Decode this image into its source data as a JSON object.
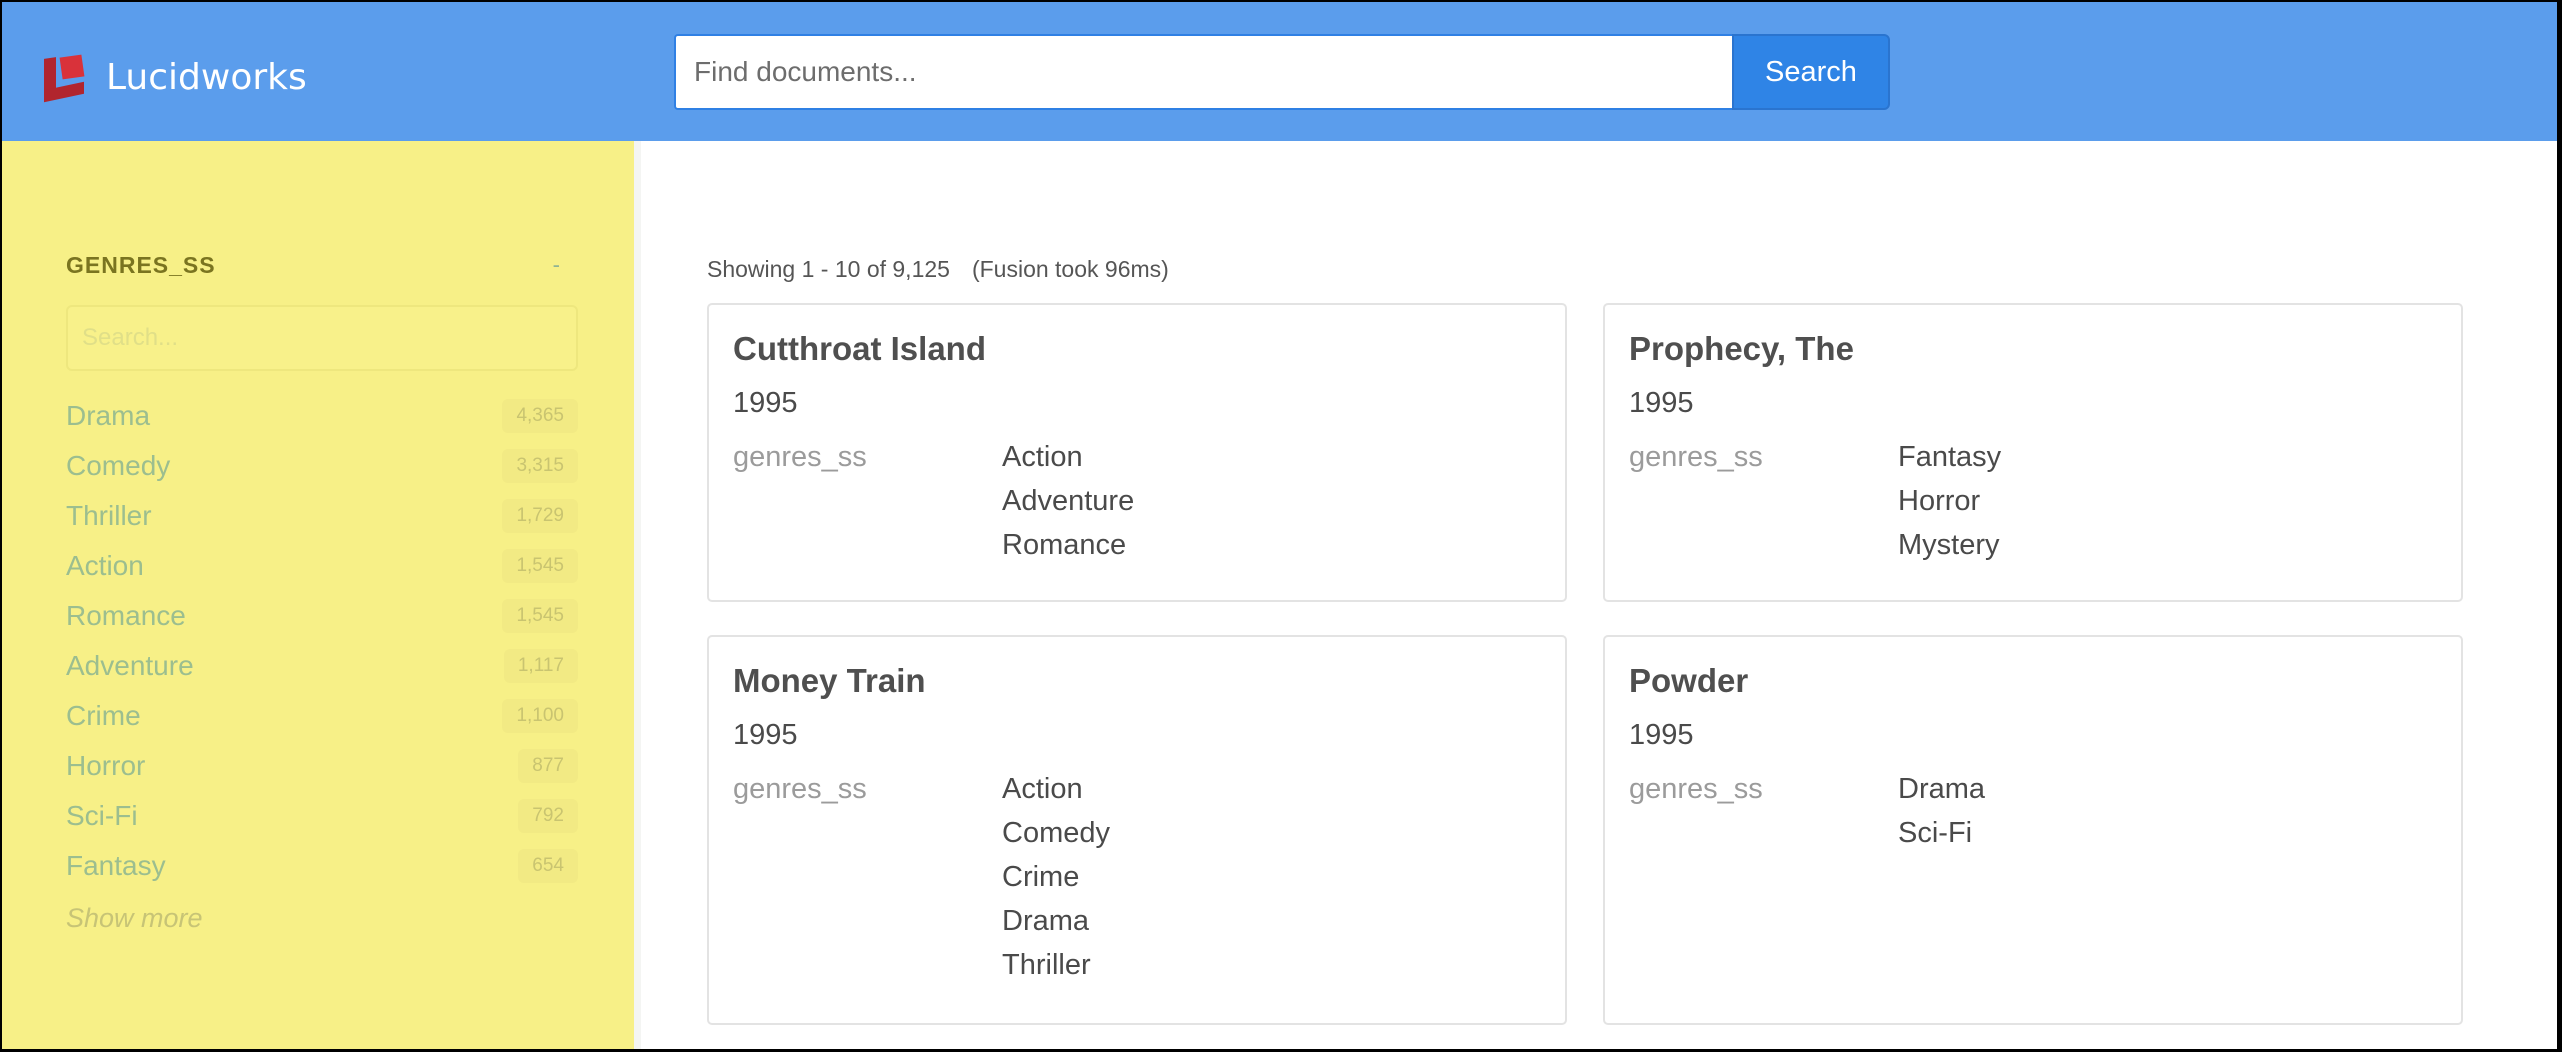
{
  "header": {
    "logo_text": "Lucidworks",
    "search": {
      "placeholder": "Find documents...",
      "value": ""
    },
    "search_button_label": "Search"
  },
  "colors": {
    "header_bg": "#5b9dec",
    "sidebar_bg": "#f7f087",
    "search_button": "#2f84e6",
    "logo_red": "#b1252e"
  },
  "sidebar": {
    "facet_title": "GENRES_SS",
    "collapse_label": "-",
    "search_placeholder": "Search...",
    "items": [
      {
        "label": "Drama",
        "count": "4,365"
      },
      {
        "label": "Comedy",
        "count": "3,315"
      },
      {
        "label": "Thriller",
        "count": "1,729"
      },
      {
        "label": "Action",
        "count": "1,545"
      },
      {
        "label": "Romance",
        "count": "1,545"
      },
      {
        "label": "Adventure",
        "count": "1,117"
      },
      {
        "label": "Crime",
        "count": "1,100"
      },
      {
        "label": "Horror",
        "count": "877"
      },
      {
        "label": "Sci-Fi",
        "count": "792"
      },
      {
        "label": "Fantasy",
        "count": "654"
      }
    ],
    "show_more_label": "Show more"
  },
  "main": {
    "summary": "Showing 1 - 10 of 9,125",
    "took": "(Fusion took 96ms)",
    "results": [
      {
        "title": "Cutthroat Island",
        "year": "1995",
        "field_label": "genres_ss",
        "values": [
          "Action",
          "Adventure",
          "Romance"
        ]
      },
      {
        "title": "Prophecy, The",
        "year": "1995",
        "field_label": "genres_ss",
        "values": [
          "Fantasy",
          "Horror",
          "Mystery"
        ]
      },
      {
        "title": "Money Train",
        "year": "1995",
        "field_label": "genres_ss",
        "values": [
          "Action",
          "Comedy",
          "Crime",
          "Drama",
          "Thriller"
        ]
      },
      {
        "title": "Powder",
        "year": "1995",
        "field_label": "genres_ss",
        "values": [
          "Drama",
          "Sci-Fi"
        ]
      }
    ]
  }
}
